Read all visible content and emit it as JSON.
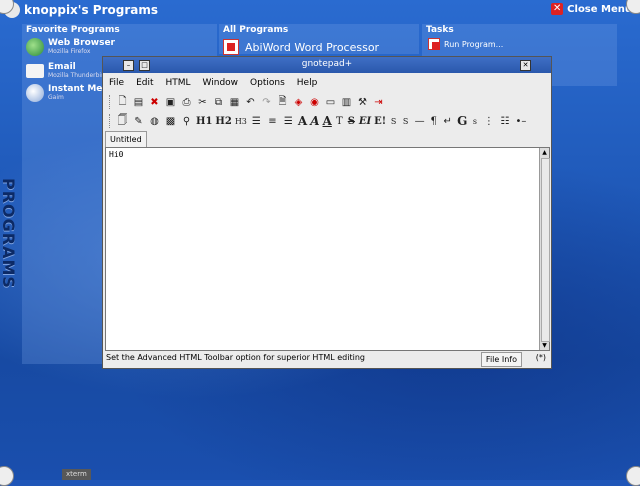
{
  "header": {
    "title": "knoppix's Programs",
    "close_label": "Close Menu"
  },
  "favorites": {
    "heading": "Favorite Programs",
    "items": [
      {
        "title": "Web Browser",
        "subtitle": "Mozilla Firefox",
        "icon": "globe-icon"
      },
      {
        "title": "Email",
        "subtitle": "Mozilla Thunderbird",
        "icon": "envelope-icon"
      },
      {
        "title": "Instant Messenger",
        "subtitle": "Gaim",
        "icon": "chat-icon"
      }
    ]
  },
  "all_programs": {
    "heading": "All Programs",
    "item": "AbiWord Word Processor"
  },
  "tasks": {
    "heading": "Tasks",
    "item": "Run Program..."
  },
  "side_label": "PROGRAMS",
  "taskbar": {
    "xterm": "xterm"
  },
  "window": {
    "title": "gnotepad+",
    "menu": [
      "File",
      "Edit",
      "HTML",
      "Window",
      "Options",
      "Help"
    ],
    "tab": "Untitled",
    "content": "Hi0",
    "status": "Set the Advanced HTML Toolbar option for superior HTML editing",
    "file_info": "File Info",
    "status_marker": "(*)"
  },
  "toolbar2_text": [
    "H1",
    "H2",
    "H3",
    "A",
    "A",
    "A",
    "T",
    "S",
    "EI",
    "E!",
    "S",
    "S",
    "¶",
    "G",
    "s"
  ],
  "colors": {
    "titlebar": "#2a58ac",
    "desktop": "#1f56b8",
    "close_red": "#dd2222"
  }
}
